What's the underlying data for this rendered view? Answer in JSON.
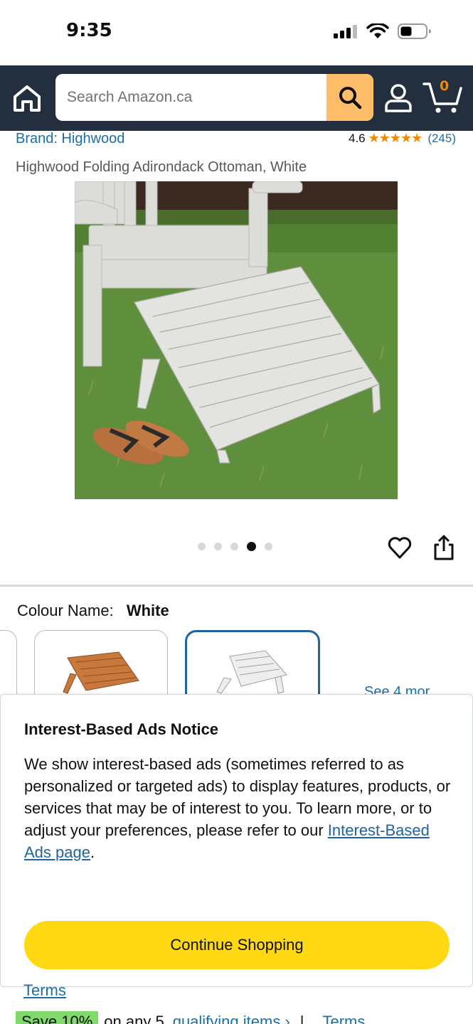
{
  "status_bar": {
    "time": "9:35"
  },
  "header": {
    "search": {
      "placeholder": "Search Amazon.ca",
      "value": ""
    },
    "cart_count": "0"
  },
  "product": {
    "brand": "Brand: Highwood",
    "rating": {
      "value": "4.6",
      "stars": "★★★★★",
      "count": "(245)"
    },
    "title": "Highwood Folding Adirondack Ottoman, White",
    "carousel": {
      "total": 5,
      "active_index": 3
    }
  },
  "variation": {
    "label": "Colour Name:",
    "selected": "White",
    "see_more": "See 4 mor"
  },
  "modal": {
    "title": "Interest-Based Ads Notice",
    "body": "We show interest-based ads (sometimes referred to as personalized or targeted ads) to display features, products, or services that may be of interest to you. To learn more, or to adjust your preferences, please refer to our ",
    "link": "Interest-Based Ads page",
    "body_end": ".",
    "button": "Continue Shopping"
  },
  "footer": {
    "terms": "Terms",
    "save_badge": "Save 10%",
    "save_text": "on any 5",
    "qualifying": "qualifying items ›",
    "separator": "|",
    "terms2": "Terms"
  },
  "colors": {
    "header_bg": "#232f3e",
    "search_button": "#febd69",
    "cart_count": "#f08804",
    "link": "#1b6fa8",
    "primary_button": "#ffd814",
    "selected_swatch": "#2162a1",
    "save_badge": "#7fda69"
  },
  "icons": [
    "signal-icon",
    "wifi-icon",
    "battery-icon",
    "home-icon",
    "search-icon",
    "account-icon",
    "cart-icon",
    "heart-icon",
    "share-icon"
  ]
}
